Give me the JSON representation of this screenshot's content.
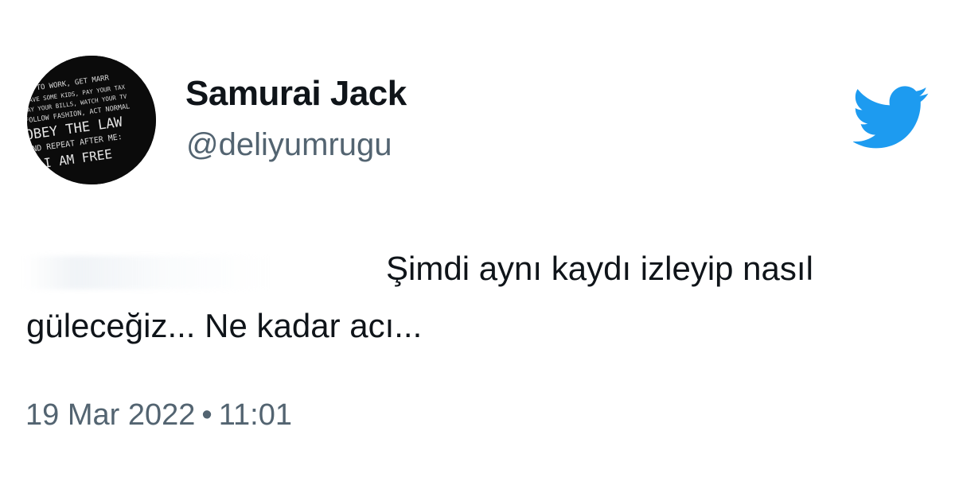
{
  "tweet": {
    "author": {
      "display_name": "Samurai Jack",
      "handle": "@deliyumrugu",
      "avatar_lines": [
        "TO WORK, GET MARR",
        "HAVE SOME KIDS, PAY YOUR TAX",
        "PAY YOUR BILLS, WATCH YOUR TV",
        "FOLLOW FASHION, ACT NORMAL",
        "OBEY THE LAW",
        "AND REPEAT AFTER ME:",
        "I AM FREE"
      ]
    },
    "text": "Şimdi aynı kaydı izleyip nasıl güleceğiz... Ne kadar acı...",
    "date": "19 Mar 2022",
    "separator": "•",
    "time": "11:01"
  },
  "icons": {
    "logo": "twitter-bird-icon"
  },
  "colors": {
    "twitter_blue": "#1d9bf0",
    "text_primary": "#0f1419",
    "text_secondary": "#536471",
    "background": "#ffffff"
  }
}
